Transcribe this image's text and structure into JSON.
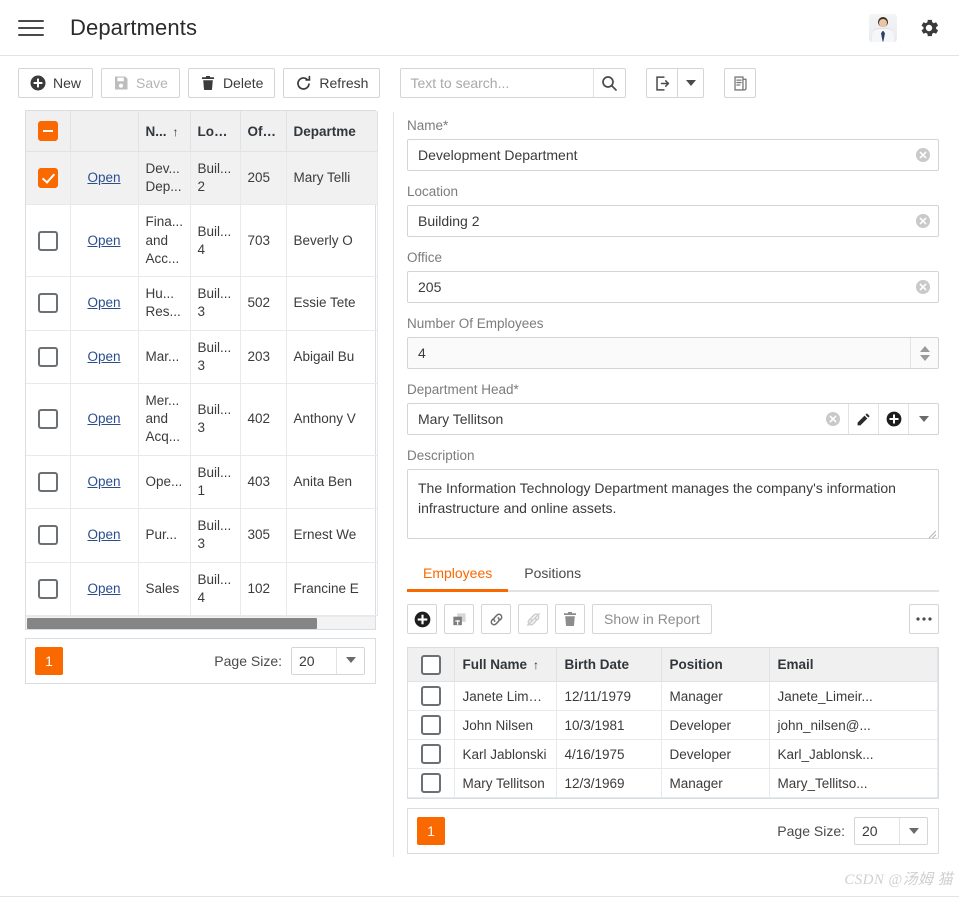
{
  "header": {
    "title": "Departments",
    "menu_icon": "hamburger-icon",
    "avatar_alt": "user-avatar",
    "settings_icon": "gear-icon"
  },
  "toolbar": {
    "new_label": "New",
    "save_label": "Save",
    "delete_label": "Delete",
    "refresh_label": "Refresh",
    "search_placeholder": "Text to search...",
    "search_value": "",
    "export_icon": "export-icon",
    "export_dropdown_icon": "chevron-down-icon",
    "report_icon": "report-icon"
  },
  "master_grid": {
    "columns": [
      "",
      "",
      "N...",
      "Loc...",
      "Offi...",
      "Departme"
    ],
    "sort_indicator": "↑",
    "sorted_column": "N...",
    "open_label": "Open",
    "rows": [
      {
        "selected": true,
        "open": "Open",
        "name": "Dev... Dep...",
        "location": "Buil... 2",
        "office": "205",
        "head": "Mary Telli"
      },
      {
        "selected": false,
        "open": "Open",
        "name": "Fina... and Acc...",
        "location": "Buil... 4",
        "office": "703",
        "head": "Beverly O"
      },
      {
        "selected": false,
        "open": "Open",
        "name": "Hu... Res...",
        "location": "Buil... 3",
        "office": "502",
        "head": "Essie Tete"
      },
      {
        "selected": false,
        "open": "Open",
        "name": "Mar...",
        "location": "Buil... 3",
        "office": "203",
        "head": "Abigail Bu"
      },
      {
        "selected": false,
        "open": "Open",
        "name": "Mer... and Acq...",
        "location": "Buil... 3",
        "office": "402",
        "head": "Anthony V"
      },
      {
        "selected": false,
        "open": "Open",
        "name": "Ope...",
        "location": "Buil... 1",
        "office": "403",
        "head": "Anita Ben"
      },
      {
        "selected": false,
        "open": "Open",
        "name": "Pur...",
        "location": "Buil... 3",
        "office": "305",
        "head": "Ernest We"
      },
      {
        "selected": false,
        "open": "Open",
        "name": "Sales",
        "location": "Buil... 4",
        "office": "102",
        "head": "Francine E"
      }
    ],
    "pager": {
      "page": "1",
      "page_size_label": "Page Size:",
      "page_size": "20"
    }
  },
  "detail": {
    "name_label": "Name*",
    "name_value": "Development Department",
    "location_label": "Location",
    "location_value": "Building 2",
    "office_label": "Office",
    "office_value": "205",
    "employees_count_label": "Number Of Employees",
    "employees_count_value": "4",
    "head_label": "Department Head*",
    "head_value": "Mary Tellitson",
    "description_label": "Description",
    "description_value": "The Information Technology Department manages the company's information infrastructure and online assets.",
    "clear_icon": "clear-circle-icon",
    "edit_icon": "pencil-icon",
    "add_icon": "plus-circle-icon",
    "dropdown_icon": "chevron-down-icon",
    "spinner_icon": "spinner-arrows-icon"
  },
  "tabs": [
    {
      "label": "Employees",
      "active": true
    },
    {
      "label": "Positions",
      "active": false
    }
  ],
  "sub_toolbar": {
    "add_icon": "plus-circle-icon",
    "duplicate_icon": "duplicate-icon",
    "link_icon": "link-icon",
    "unlink_icon": "unlink-icon",
    "delete_icon": "trash-icon",
    "report_label": "Show in Report",
    "more_icon": "ellipsis-icon"
  },
  "employees_grid": {
    "columns": [
      "Full Name",
      "Birth Date",
      "Position",
      "Email"
    ],
    "sort_indicator": "↑",
    "rows": [
      {
        "full_name": "Janete Limeira",
        "birth_date": "12/11/1979",
        "position": "Manager",
        "email": "Janete_Limeir..."
      },
      {
        "full_name": "John Nilsen",
        "birth_date": "10/3/1981",
        "position": "Developer",
        "email": "john_nilsen@..."
      },
      {
        "full_name": "Karl Jablonski",
        "birth_date": "4/16/1975",
        "position": "Developer",
        "email": "Karl_Jablonsk..."
      },
      {
        "full_name": "Mary Tellitson",
        "birth_date": "12/3/1969",
        "position": "Manager",
        "email": "Mary_Tellitso..."
      }
    ],
    "pager": {
      "page": "1",
      "page_size_label": "Page Size:",
      "page_size": "20"
    }
  },
  "watermark": "CSDN @汤姆 猫",
  "colors": {
    "accent": "#fa6800",
    "link": "#2b4e8c",
    "header_bg": "#f0f0f0",
    "border": "#d8dde1"
  }
}
